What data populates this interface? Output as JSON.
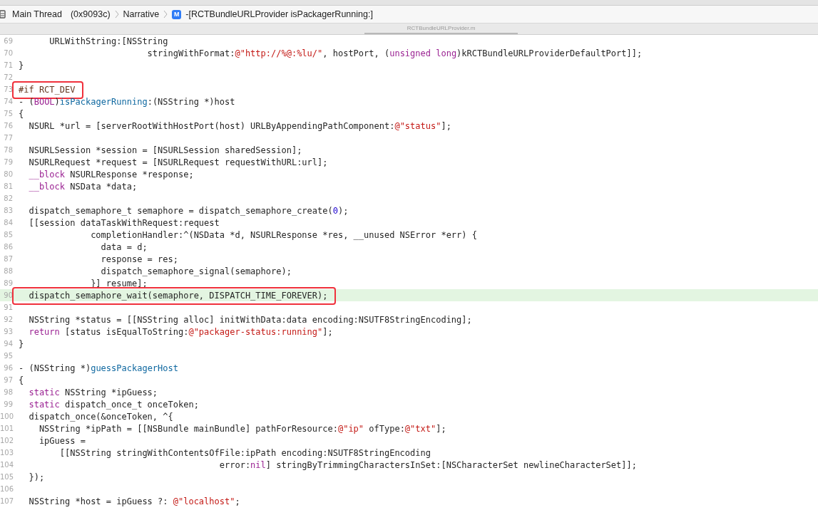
{
  "breadcrumb": {
    "thread": "Main Thread",
    "address": "(0x9093c)",
    "group": "Narrative",
    "method_badge": "M",
    "method": "-[RCTBundleURLProvider isPackagerRunning:]"
  },
  "tab": {
    "title": "RCTBundleURLProvider.m",
    "selected": true
  },
  "lines": [
    {
      "number": "69",
      "highlighted": false,
      "boxed": false,
      "tokens": [
        {
          "kind": "plain",
          "text": "      URLWithString:[NSString"
        }
      ]
    },
    {
      "number": "70",
      "highlighted": false,
      "boxed": false,
      "tokens": [
        {
          "kind": "plain",
          "text": "                         stringWithFormat:"
        },
        {
          "kind": "string",
          "text": "@\"http://%@:%lu/\""
        },
        {
          "kind": "plain",
          "text": ", hostPort, ("
        },
        {
          "kind": "keyword",
          "text": "unsigned long"
        },
        {
          "kind": "plain",
          "text": ")kRCTBundleURLProviderDefaultPort]];"
        }
      ]
    },
    {
      "number": "71",
      "highlighted": false,
      "boxed": false,
      "tokens": [
        {
          "kind": "plain",
          "text": "}"
        }
      ]
    },
    {
      "number": "72",
      "highlighted": false,
      "boxed": false
    },
    {
      "number": "73",
      "highlighted": false,
      "boxed": true,
      "tokens": [
        {
          "kind": "preprocessor",
          "text": "#if RCT_DEV"
        }
      ]
    },
    {
      "number": "74",
      "highlighted": false,
      "boxed": false,
      "tokens": [
        {
          "kind": "plain",
          "text": "- ("
        },
        {
          "kind": "keyword",
          "text": "BOOL"
        },
        {
          "kind": "plain",
          "text": ")"
        },
        {
          "kind": "method",
          "text": "isPackagerRunning"
        },
        {
          "kind": "plain",
          "text": ":(NSString *)host"
        }
      ]
    },
    {
      "number": "75",
      "highlighted": false,
      "boxed": false,
      "tokens": [
        {
          "kind": "plain",
          "text": "{"
        }
      ]
    },
    {
      "number": "76",
      "highlighted": false,
      "boxed": false,
      "tokens": [
        {
          "kind": "plain",
          "text": "  NSURL *url = [serverRootWithHostPort(host) URLByAppendingPathComponent:"
        },
        {
          "kind": "string",
          "text": "@\"status\""
        },
        {
          "kind": "plain",
          "text": "];"
        }
      ]
    },
    {
      "number": "77",
      "highlighted": false,
      "boxed": false
    },
    {
      "number": "78",
      "highlighted": false,
      "boxed": false,
      "tokens": [
        {
          "kind": "plain",
          "text": "  NSURLSession *session = [NSURLSession sharedSession];"
        }
      ]
    },
    {
      "number": "79",
      "highlighted": false,
      "boxed": false,
      "tokens": [
        {
          "kind": "plain",
          "text": "  NSURLRequest *request = [NSURLRequest requestWithURL:url];"
        }
      ]
    },
    {
      "number": "80",
      "highlighted": false,
      "boxed": false,
      "tokens": [
        {
          "kind": "keyword",
          "text": "  __block"
        },
        {
          "kind": "plain",
          "text": " NSURLResponse *response;"
        }
      ]
    },
    {
      "number": "81",
      "highlighted": false,
      "boxed": false,
      "tokens": [
        {
          "kind": "keyword",
          "text": "  __block"
        },
        {
          "kind": "plain",
          "text": " NSData *data;"
        }
      ]
    },
    {
      "number": "82",
      "highlighted": false,
      "boxed": false
    },
    {
      "number": "83",
      "highlighted": false,
      "boxed": false,
      "tokens": [
        {
          "kind": "plain",
          "text": "  dispatch_semaphore_t semaphore = dispatch_semaphore_create("
        },
        {
          "kind": "number",
          "text": "0"
        },
        {
          "kind": "plain",
          "text": ");"
        }
      ]
    },
    {
      "number": "84",
      "highlighted": false,
      "boxed": false,
      "tokens": [
        {
          "kind": "plain",
          "text": "  [[session dataTaskWithRequest:request"
        }
      ]
    },
    {
      "number": "85",
      "highlighted": false,
      "boxed": false,
      "tokens": [
        {
          "kind": "plain",
          "text": "              completionHandler:^(NSData *d, NSURLResponse *res, __unused NSError *err) {"
        }
      ]
    },
    {
      "number": "86",
      "highlighted": false,
      "boxed": false,
      "tokens": [
        {
          "kind": "plain",
          "text": "                data = d;"
        }
      ]
    },
    {
      "number": "87",
      "highlighted": false,
      "boxed": false,
      "tokens": [
        {
          "kind": "plain",
          "text": "                response = res;"
        }
      ]
    },
    {
      "number": "88",
      "highlighted": false,
      "boxed": false,
      "tokens": [
        {
          "kind": "plain",
          "text": "                dispatch_semaphore_signal(semaphore);"
        }
      ]
    },
    {
      "number": "89",
      "highlighted": false,
      "boxed": false,
      "tokens": [
        {
          "kind": "plain",
          "text": "              }] resume];"
        }
      ]
    },
    {
      "number": "90",
      "highlighted": true,
      "boxed": true,
      "tokens": [
        {
          "kind": "plain",
          "text": "  dispatch_semaphore_wait(semaphore, DISPATCH_TIME_FOREVER);"
        }
      ]
    },
    {
      "number": "91",
      "highlighted": false,
      "boxed": false
    },
    {
      "number": "92",
      "highlighted": false,
      "boxed": false,
      "tokens": [
        {
          "kind": "plain",
          "text": "  NSString *status = [[NSString alloc] initWithData:data encoding:NSUTF8StringEncoding];"
        }
      ]
    },
    {
      "number": "93",
      "highlighted": false,
      "boxed": false,
      "tokens": [
        {
          "kind": "keyword",
          "text": "  return"
        },
        {
          "kind": "plain",
          "text": " [status isEqualToString:"
        },
        {
          "kind": "string",
          "text": "@\"packager-status:running\""
        },
        {
          "kind": "plain",
          "text": "];"
        }
      ]
    },
    {
      "number": "94",
      "highlighted": false,
      "boxed": false,
      "tokens": [
        {
          "kind": "plain",
          "text": "}"
        }
      ]
    },
    {
      "number": "95",
      "highlighted": false,
      "boxed": false
    },
    {
      "number": "96",
      "highlighted": false,
      "boxed": false,
      "tokens": [
        {
          "kind": "plain",
          "text": "- (NSString *)"
        },
        {
          "kind": "method",
          "text": "guessPackagerHost"
        }
      ]
    },
    {
      "number": "97",
      "highlighted": false,
      "boxed": false,
      "tokens": [
        {
          "kind": "plain",
          "text": "{"
        }
      ]
    },
    {
      "number": "98",
      "highlighted": false,
      "boxed": false,
      "tokens": [
        {
          "kind": "keyword",
          "text": "  static"
        },
        {
          "kind": "plain",
          "text": " NSString *ipGuess;"
        }
      ]
    },
    {
      "number": "99",
      "highlighted": false,
      "boxed": false,
      "tokens": [
        {
          "kind": "keyword",
          "text": "  static"
        },
        {
          "kind": "plain",
          "text": " dispatch_once_t onceToken;"
        }
      ]
    },
    {
      "number": "100",
      "highlighted": false,
      "boxed": false,
      "tokens": [
        {
          "kind": "plain",
          "text": "  dispatch_once(&onceToken, ^{"
        }
      ]
    },
    {
      "number": "101",
      "highlighted": false,
      "boxed": false,
      "tokens": [
        {
          "kind": "plain",
          "text": "    NSString *ipPath = [[NSBundle mainBundle] pathForResource:"
        },
        {
          "kind": "string",
          "text": "@\"ip\""
        },
        {
          "kind": "plain",
          "text": " ofType:"
        },
        {
          "kind": "string",
          "text": "@\"txt\""
        },
        {
          "kind": "plain",
          "text": "];"
        }
      ]
    },
    {
      "number": "102",
      "highlighted": false,
      "boxed": false,
      "tokens": [
        {
          "kind": "plain",
          "text": "    ipGuess ="
        }
      ]
    },
    {
      "number": "103",
      "highlighted": false,
      "boxed": false,
      "tokens": [
        {
          "kind": "plain",
          "text": "        [[NSString stringWithContentsOfFile:ipPath encoding:NSUTF8StringEncoding"
        }
      ]
    },
    {
      "number": "104",
      "highlighted": false,
      "boxed": false,
      "tokens": [
        {
          "kind": "plain",
          "text": "                                       error:"
        },
        {
          "kind": "keyword",
          "text": "nil"
        },
        {
          "kind": "plain",
          "text": "] stringByTrimmingCharactersInSet:[NSCharacterSet newlineCharacterSet]];"
        }
      ]
    },
    {
      "number": "105",
      "highlighted": false,
      "boxed": false,
      "tokens": [
        {
          "kind": "plain",
          "text": "  });"
        }
      ]
    },
    {
      "number": "106",
      "highlighted": false,
      "boxed": false
    },
    {
      "number": "107",
      "highlighted": false,
      "boxed": false,
      "tokens": [
        {
          "kind": "plain",
          "text": "  NSString *host = ipGuess ?: "
        },
        {
          "kind": "string",
          "text": "@\"localhost\""
        },
        {
          "kind": "plain",
          "text": ";"
        }
      ]
    }
  ]
}
